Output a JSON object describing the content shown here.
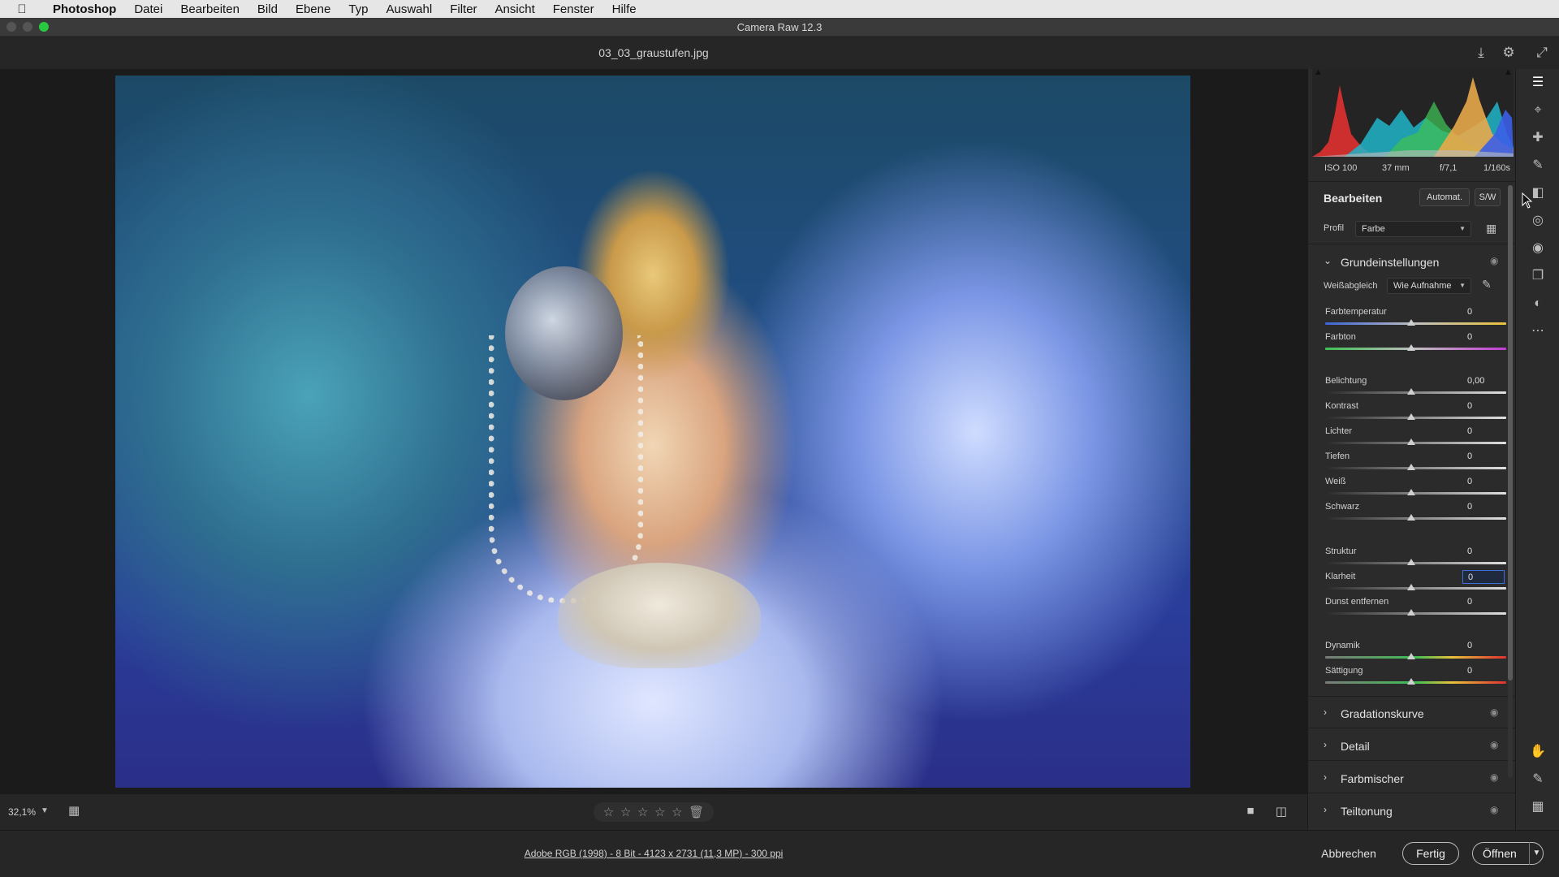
{
  "menubar": {
    "app": "Photoshop",
    "items": [
      "Datei",
      "Bearbeiten",
      "Bild",
      "Ebene",
      "Typ",
      "Auswahl",
      "Filter",
      "Ansicht",
      "Fenster",
      "Hilfe"
    ]
  },
  "window": {
    "title": "Camera Raw 12.3"
  },
  "document": {
    "filename": "03_03_graustufen.jpg"
  },
  "canvas_bar": {
    "zoom": "32,1%",
    "view_icons": [
      "single-view-icon",
      "before-after-icon"
    ]
  },
  "status": {
    "info": "Adobe RGB (1998) - 8 Bit - 4123 x 2731 (11,3 MP) - 300 ppi",
    "cancel": "Abbrechen",
    "done": "Fertig",
    "open": "Öffnen"
  },
  "camera": {
    "iso": "ISO 100",
    "focal": "37 mm",
    "aperture": "f/7,1",
    "shutter": "1/160s"
  },
  "edit": {
    "title": "Bearbeiten",
    "auto": "Automat.",
    "bw": "S/W",
    "profile_label": "Profil",
    "profile_value": "Farbe"
  },
  "basic": {
    "title": "Grundeinstellungen",
    "wb_label": "Weißabgleich",
    "wb_value": "Wie Aufnahme",
    "sliders": [
      {
        "label": "Farbtemperatur",
        "value": "0"
      },
      {
        "label": "Farbton",
        "value": "0"
      },
      {
        "label": "Belichtung",
        "value": "0,00"
      },
      {
        "label": "Kontrast",
        "value": "0"
      },
      {
        "label": "Lichter",
        "value": "0"
      },
      {
        "label": "Tiefen",
        "value": "0"
      },
      {
        "label": "Weiß",
        "value": "0"
      },
      {
        "label": "Schwarz",
        "value": "0"
      },
      {
        "label": "Struktur",
        "value": "0"
      },
      {
        "label": "Klarheit",
        "value": "0"
      },
      {
        "label": "Dunst entfernen",
        "value": "0"
      },
      {
        "label": "Dynamik",
        "value": "0"
      },
      {
        "label": "Sättigung",
        "value": "0"
      }
    ]
  },
  "sections": [
    "Gradationskurve",
    "Detail",
    "Farbmischer",
    "Teiltonung"
  ],
  "colors": {
    "accent": "#3d6fd6",
    "panel_bg": "#2b2b2b",
    "maximize": "#28c840"
  }
}
